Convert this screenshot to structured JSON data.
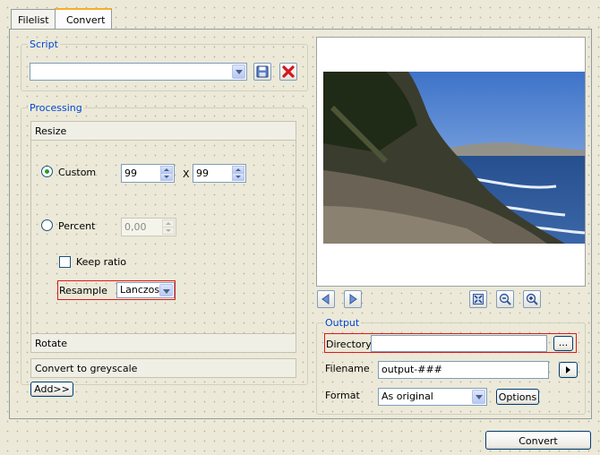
{
  "tabs": [
    {
      "label": "Filelist",
      "active": false
    },
    {
      "label": "Convert",
      "active": true
    }
  ],
  "script": {
    "legend": "Script",
    "selected": "",
    "save_icon": "floppy-save-icon",
    "delete_icon": "red-x-delete-icon"
  },
  "processing": {
    "legend": "Processing",
    "resize": {
      "title": "Resize",
      "custom_label": "Custom",
      "custom_selected": true,
      "width": "99",
      "x_label": "X",
      "height": "99",
      "percent_label": "Percent",
      "percent_value": "0,00",
      "keep_ratio_label": "Keep ratio",
      "keep_ratio_checked": false,
      "resample_label": "Resample",
      "resample_value": "Lanczos"
    },
    "rotate_label": "Rotate",
    "greyscale_label": "Convert to greyscale",
    "add_button": "Add>>"
  },
  "preview": {
    "image_desc": "coastal-landscape-photo",
    "nav_icons": [
      "prev-arrow-icon",
      "next-arrow-icon",
      "fit-to-window-icon",
      "zoom-out-icon",
      "zoom-in-icon"
    ]
  },
  "output": {
    "legend": "Output",
    "directory_label": "Directory",
    "directory_value": "",
    "browse_button": "...",
    "filename_label": "Filename",
    "filename_value": "output-###",
    "format_label": "Format",
    "format_value": "As original",
    "options_button": "Options"
  },
  "convert_button": "Convert",
  "colors": {
    "legend": "#0046d5",
    "highlight": "#e0171b",
    "tab_accent": "#f6b026"
  }
}
